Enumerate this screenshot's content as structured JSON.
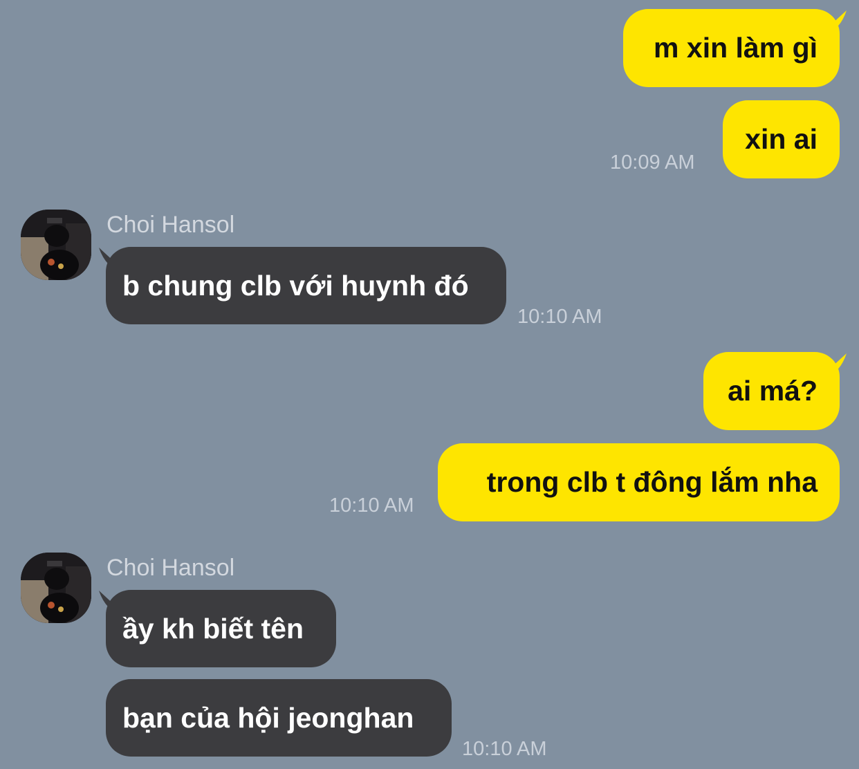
{
  "colors": {
    "background": "#8190a0",
    "outgoing_bubble": "#fee500",
    "incoming_bubble": "#3c3c3f",
    "timestamp": "#c9d0d9",
    "sender_name": "#d3d8df"
  },
  "messages": [
    {
      "direction": "outgoing",
      "text": "m xin làm gì"
    },
    {
      "direction": "outgoing",
      "text": "xin ai",
      "time": "10:09 AM"
    },
    {
      "direction": "incoming",
      "sender": "Choi Hansol",
      "avatar_icon": "profile-photo",
      "text": "b chung clb với huynh đó",
      "time": "10:10 AM"
    },
    {
      "direction": "outgoing",
      "text": "ai má?"
    },
    {
      "direction": "outgoing",
      "text": "trong clb t đông lắm nha",
      "time": "10:10 AM"
    },
    {
      "direction": "incoming",
      "sender": "Choi Hansol",
      "avatar_icon": "profile-photo",
      "text": "ầy kh biết tên"
    },
    {
      "direction": "incoming",
      "text": "bạn của hội jeonghan",
      "time": "10:10 AM"
    }
  ]
}
